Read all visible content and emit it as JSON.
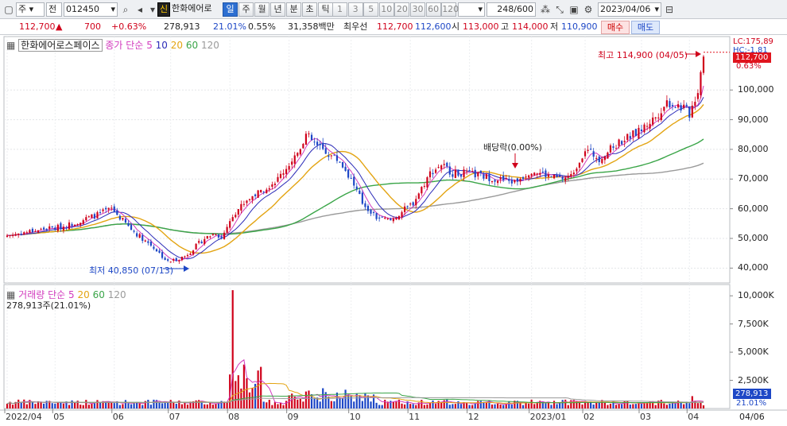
{
  "toolbar": {
    "market": "주",
    "prev": "전",
    "code": "012450",
    "badge": "신",
    "stock_name": "한화에어로",
    "periods": [
      "일",
      "주",
      "월",
      "년",
      "분",
      "초",
      "틱"
    ],
    "intervals": [
      "1",
      "3",
      "5",
      "10",
      "20",
      "30",
      "60",
      "120"
    ],
    "count": "248",
    "total": "/600",
    "date": "2023/04/06"
  },
  "info": {
    "price": "112,700",
    "arrow": "▲",
    "change": "700",
    "change_pct": "+0.63%",
    "volume": "278,913",
    "turnover": "21.01%",
    "ratio": "0.55%",
    "amount": "31,358백만",
    "best_label": "최우선",
    "best_ask": "112,700",
    "best_bid": "112,600",
    "open_label": "시",
    "open": "113,000",
    "high_label": "고",
    "high": "114,000",
    "low_label": "저",
    "low": "110,900",
    "buy": "매수",
    "sell": "매도"
  },
  "price_legend": {
    "name": "한화에어로스페이스",
    "type": "종가 단순",
    "ma": [
      "5",
      "10",
      "20",
      "60",
      "120"
    ]
  },
  "vol_legend": {
    "name": "거래량",
    "type": "단순",
    "ma": [
      "5",
      "20",
      "60",
      "120"
    ],
    "value": "278,913주(21.01%)"
  },
  "annotations": {
    "high": "최고 114,900 (04/05)",
    "low": "최저 40,850 (07/13)",
    "dividend": "배당락(0.00%)"
  },
  "axis": {
    "lc": "LC:175,89",
    "hc": "HC:-1.81",
    "price_tag": "112,700",
    "price_pct": "0.63%",
    "vol_tag": "278,913",
    "vol_pct": "21.01%",
    "price_ticks": [
      "100,000",
      "90,000",
      "80,000",
      "70,000",
      "60,000",
      "50,000",
      "40,000"
    ],
    "vol_ticks": [
      "10,000K",
      "7,500K",
      "5,000K",
      "2,500K"
    ],
    "x_ticks": [
      "2022/04",
      "05",
      "06",
      "07",
      "08",
      "09",
      "10",
      "11",
      "12",
      "2023/01",
      "02",
      "03",
      "04"
    ],
    "x_end": "04/06"
  },
  "colors": {
    "up": "#d0021b",
    "down": "#1d47c6",
    "ma5": "#d23cbe",
    "ma10": "#2b2bb8",
    "ma20": "#e3a412",
    "ma60": "#3aa548",
    "ma120": "#9a9a9a"
  },
  "chart_data": [
    {
      "type": "candlestick",
      "name": "한화에어로스페이스",
      "ylim": [
        35000,
        118000
      ],
      "x": [
        "2022/04",
        "05",
        "06",
        "07",
        "08",
        "09",
        "10",
        "11",
        "12",
        "2023/01",
        "02",
        "03",
        "04"
      ],
      "close_approx": [
        51000,
        56000,
        57000,
        47000,
        43000,
        62000,
        84000,
        58000,
        71000,
        70000,
        68000,
        74000,
        97000,
        112700
      ],
      "high": 114900,
      "low": 40850
    },
    {
      "type": "bar",
      "name": "거래량",
      "ylim": [
        0,
        11000
      ],
      "unit": "K",
      "peak": 10500,
      "last": 278.913
    }
  ]
}
